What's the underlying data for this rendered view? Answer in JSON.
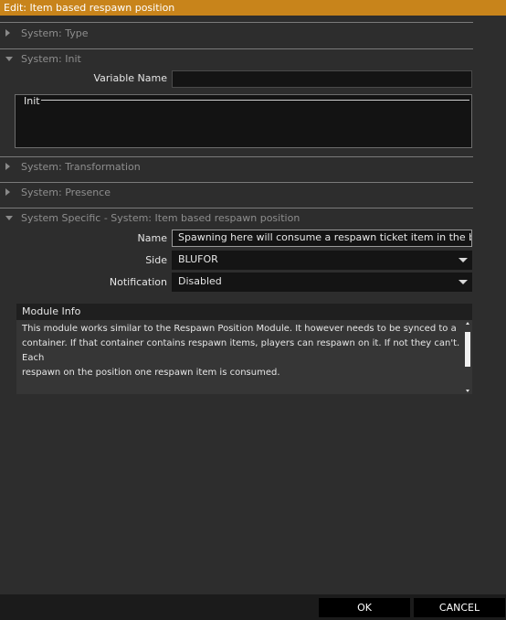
{
  "window": {
    "title": "Edit: Item based respawn position"
  },
  "sections": {
    "type": {
      "label": "System: Type"
    },
    "init": {
      "label": "System: Init"
    },
    "transformation": {
      "label": "System: Transformation"
    },
    "presence": {
      "label": "System: Presence"
    },
    "specific": {
      "label": "System Specific - System: Item based respawn position"
    }
  },
  "init_section": {
    "variable_name_label": "Variable Name",
    "variable_name_value": "",
    "init_label": "Init",
    "init_value": ""
  },
  "specific_section": {
    "name_label": "Name",
    "name_value": "Spawning here will consume a respawn ticket item in the box",
    "side_label": "Side",
    "side_value": "BLUFOR",
    "notification_label": "Notification",
    "notification_value": "Disabled"
  },
  "module_info": {
    "title": "Module Info",
    "text": "This module works similar to the Respawn Position Module. It however needs to be synced to a\ncontainer. If that container contains respawn items, players can respawn on it. If not they can't. Each\nrespawn on the position one respawn item is consumed.\n\nPosition: Affects module function"
  },
  "buttons": {
    "ok": "OK",
    "cancel": "CANCEL"
  },
  "colors": {
    "title_bar": "#c8841b",
    "background": "#2d2d2d",
    "field": "#141414"
  }
}
